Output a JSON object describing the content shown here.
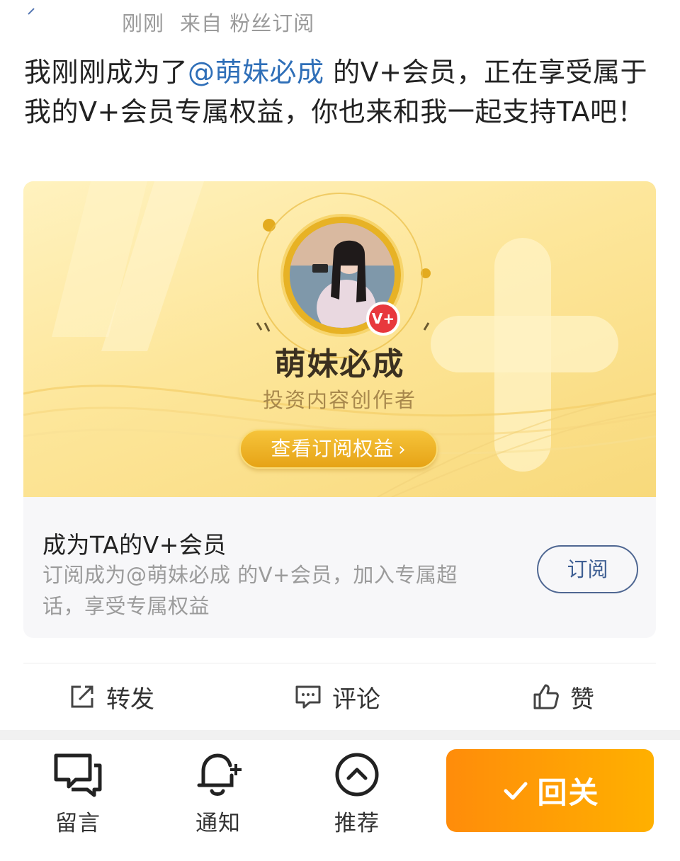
{
  "meta": {
    "time": "刚刚",
    "source": "来自 粉丝订阅"
  },
  "post": {
    "prefix": "我刚刚成为了",
    "mention": "@萌妹必成",
    "suffix": " 的V+会员，正在享受属于我的V+会员专属权益，你也来和我一起支持TA吧！"
  },
  "card": {
    "banner": {
      "creator_name": "萌妹必成",
      "creator_role": "投资内容创作者",
      "benefits_button": "查看订阅权益",
      "badge_text": "V+"
    },
    "title": "成为TA的V+会员",
    "description": "订阅成为@萌妹必成 的V+会员，加入专属超话，享受专属权益",
    "subscribe_button": "订阅"
  },
  "actions": {
    "repost": "转发",
    "comment": "评论",
    "like": "赞"
  },
  "bottom_nav": {
    "message": "留言",
    "notify": "通知",
    "recommend": "推荐",
    "follow_back": "回关"
  },
  "colors": {
    "mention_blue": "#2f6fb8",
    "gold": "#e6a316",
    "follow_orange": "#ff8c0a"
  }
}
